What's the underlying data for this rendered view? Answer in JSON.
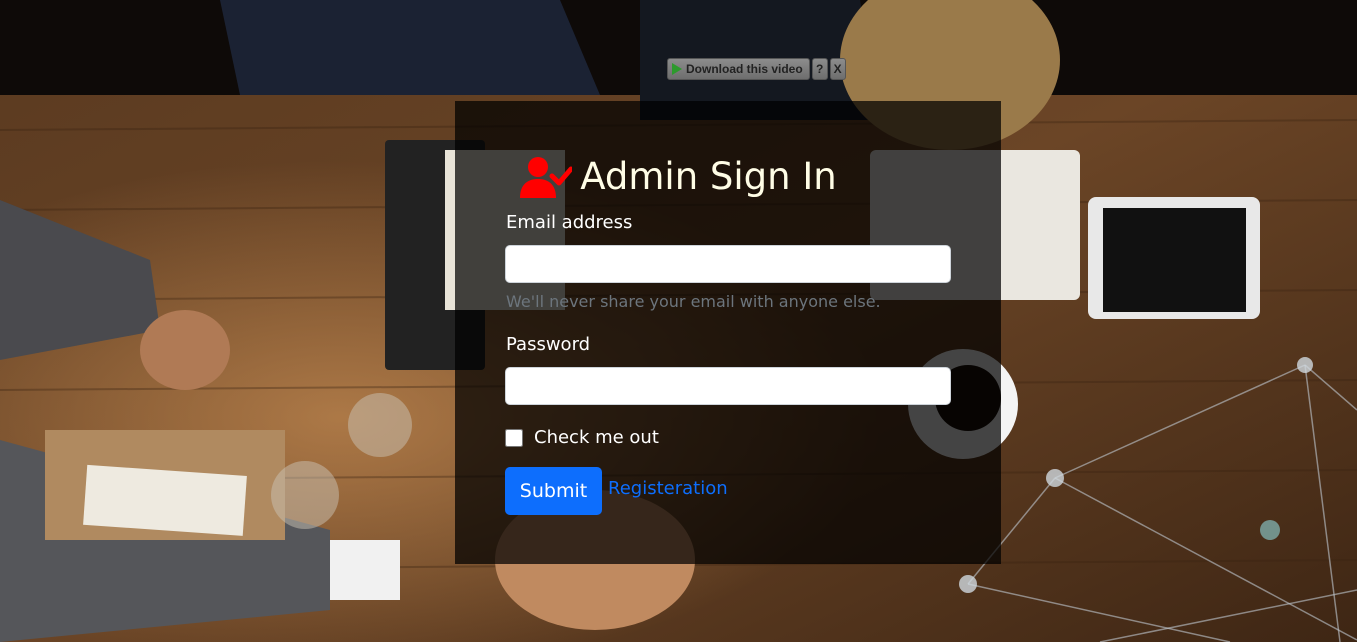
{
  "download_bar": {
    "label": "Download this video",
    "help_label": "?",
    "close_label": "X"
  },
  "form": {
    "title": "Admin Sign In",
    "email_label": "Email address",
    "email_value": "",
    "email_help": "We'll never share your email with anyone else.",
    "password_label": "Password",
    "password_value": "",
    "checkbox_label": "Check me out",
    "checkbox_checked": false,
    "submit_label": "Submit",
    "register_link": "Registeration"
  },
  "colors": {
    "primary": "#0d6efd",
    "icon": "#ff0000",
    "title": "#fffde6",
    "help_text": "#6c757d"
  },
  "icons": {
    "title_icon": "user-check-icon",
    "download_icon": "play-icon"
  }
}
